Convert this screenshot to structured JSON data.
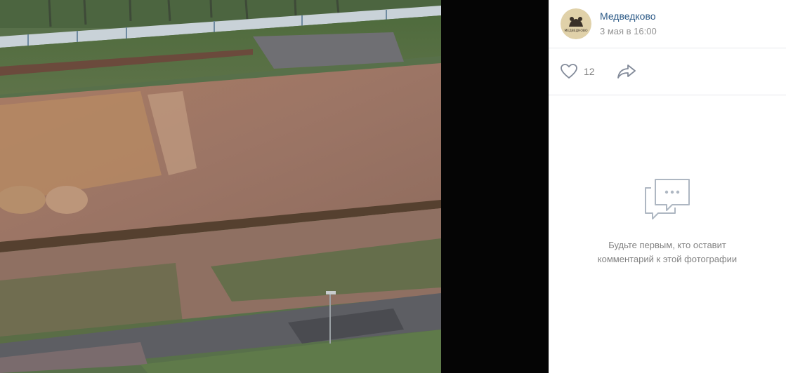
{
  "author": {
    "name": "Медведково",
    "date": "3 мая в 16:00",
    "avatar_text": "МЕДВЕДКОВО"
  },
  "actions": {
    "likes": "12"
  },
  "comments": {
    "empty_line1": "Будьте первым, кто оставит",
    "empty_line2": "комментарий к этой фотографии"
  },
  "colors": {
    "link": "#2a5885",
    "muted": "#828282",
    "date": "#939393",
    "icon": "#aeb7c2"
  }
}
